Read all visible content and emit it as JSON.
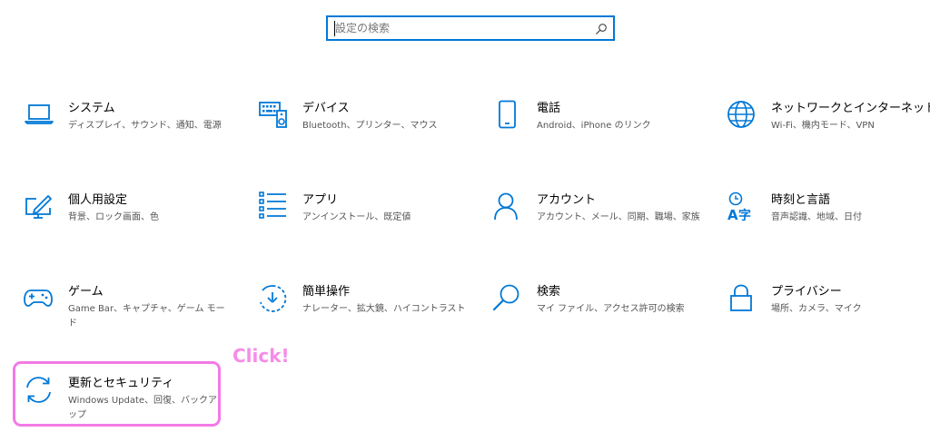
{
  "search": {
    "placeholder": "設定の検索"
  },
  "colors": {
    "accent": "#0078d7",
    "annotation": "#f37ae6"
  },
  "tiles": [
    {
      "id": "system",
      "icon": "laptop-icon",
      "title": "システム",
      "desc": "ディスプレイ、サウンド、通知、電源"
    },
    {
      "id": "devices",
      "icon": "keyboard-speaker-icon",
      "title": "デバイス",
      "desc": "Bluetooth、プリンター、マウス"
    },
    {
      "id": "phone",
      "icon": "phone-icon",
      "title": "電話",
      "desc": "Android、iPhone のリンク"
    },
    {
      "id": "network",
      "icon": "globe-icon",
      "title": "ネットワークとインターネット",
      "desc": "Wi-Fi、機内モード、VPN"
    },
    {
      "id": "personalization",
      "icon": "pen-monitor-icon",
      "title": "個人用設定",
      "desc": "背景、ロック画面、色"
    },
    {
      "id": "apps",
      "icon": "list-icon",
      "title": "アプリ",
      "desc": "アンインストール、既定値"
    },
    {
      "id": "accounts",
      "icon": "person-icon",
      "title": "アカウント",
      "desc": "アカウント、メール、同期、職場、家族"
    },
    {
      "id": "time-language",
      "icon": "language-clock-icon",
      "title": "時刻と言語",
      "desc": "音声認識、地域、日付"
    },
    {
      "id": "gaming",
      "icon": "gamepad-icon",
      "title": "ゲーム",
      "desc": "Game Bar、キャプチャ、ゲーム モード"
    },
    {
      "id": "ease-of-access",
      "icon": "ease-of-access-icon",
      "title": "簡単操作",
      "desc": "ナレーター、拡大鏡、ハイコントラスト"
    },
    {
      "id": "search",
      "icon": "magnifier-icon",
      "title": "検索",
      "desc": "マイ ファイル、アクセス許可の検索"
    },
    {
      "id": "privacy",
      "icon": "lock-icon",
      "title": "プライバシー",
      "desc": "場所、カメラ、マイク"
    },
    {
      "id": "update-security",
      "icon": "sync-icon",
      "title": "更新とセキュリティ",
      "desc": "Windows Update、回復、バックアップ"
    }
  ],
  "annotation": {
    "label": "Click!"
  }
}
